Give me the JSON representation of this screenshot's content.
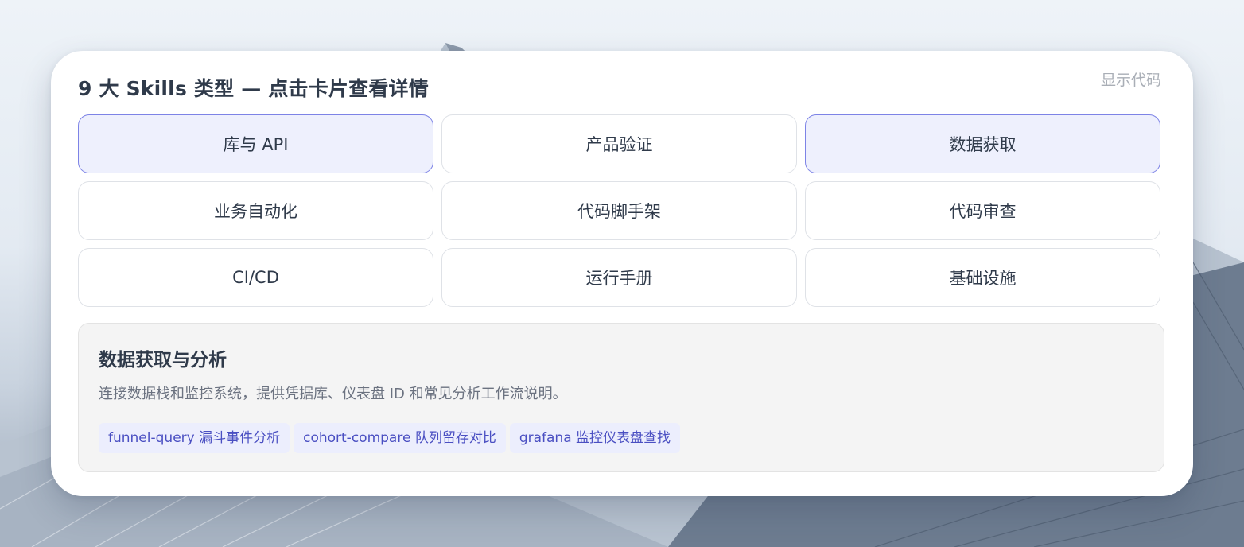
{
  "panel": {
    "title": "9 大 Skills 类型 — 点击卡片查看详情",
    "show_code_label": "显示代码"
  },
  "skill_types": [
    {
      "label": "库与 API",
      "selected": true
    },
    {
      "label": "产品验证",
      "selected": false
    },
    {
      "label": "数据获取",
      "selected": true
    },
    {
      "label": "业务自动化",
      "selected": false
    },
    {
      "label": "代码脚手架",
      "selected": false
    },
    {
      "label": "代码审查",
      "selected": false
    },
    {
      "label": "CI/CD",
      "selected": false
    },
    {
      "label": "运行手册",
      "selected": false
    },
    {
      "label": "基础设施",
      "selected": false
    }
  ],
  "detail": {
    "title": "数据获取与分析",
    "description": "连接数据栈和监控系统，提供凭据库、仪表盘 ID 和常见分析工作流说明。",
    "tags": [
      "funnel-query 漏斗事件分析",
      "cohort-compare 队列留存对比",
      "grafana 监控仪表盘查找"
    ]
  },
  "colors": {
    "accent": "#5b5fd6",
    "selected_bg": "#eef0fd",
    "selected_border": "#7d83e6",
    "tag_text": "#4a4fc2"
  }
}
